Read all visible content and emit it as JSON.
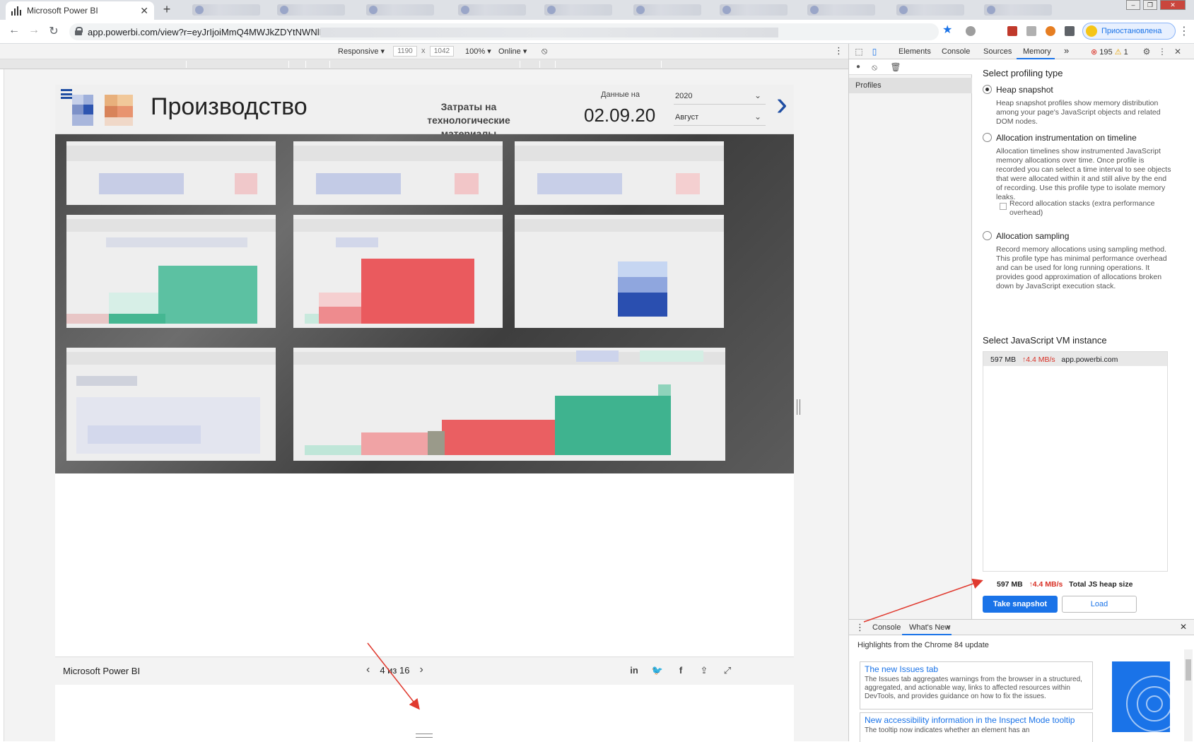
{
  "browser": {
    "active_tab_title": "Microsoft Power BI",
    "url": "app.powerbi.com/view?r=eyJrIjoiMmQ4MWJkZDYtNWNlMi",
    "profile_label": "Приостановлена"
  },
  "device_toolbar": {
    "mode": "Responsive ▾",
    "width": "1190",
    "x": "x",
    "height": "1042",
    "zoom": "100% ▾",
    "network": "Online ▾"
  },
  "report": {
    "title": "Производство",
    "subtitle": "Затраты на технологические материалы",
    "date_label": "Данные на",
    "date_value": "02.09.20",
    "year_slicer": "2020",
    "month_slicer": "Август",
    "footer_brand": "Microsoft Power BI",
    "pager": "4 из 16"
  },
  "devtools": {
    "tabs": [
      "Elements",
      "Console",
      "Sources",
      "Memory"
    ],
    "more_tabs": "»",
    "error_count": "195",
    "warning_count": "1",
    "sidebar_item": "Profiles",
    "select_type_heading": "Select profiling type",
    "options": [
      {
        "label": "Heap snapshot",
        "selected": true,
        "desc": "Heap snapshot profiles show memory distribution among your page's JavaScript objects and related DOM nodes."
      },
      {
        "label": "Allocation instrumentation on timeline",
        "selected": false,
        "desc": "Allocation timelines show instrumented JavaScript memory allocations over time. Once profile is recorded you can select a time interval to see objects that were allocated within it and still alive by the end of recording. Use this profile type to isolate memory leaks."
      },
      {
        "label": "Allocation sampling",
        "selected": false,
        "desc": "Record memory allocations using sampling method. This profile type has minimal performance overhead and can be used for long running operations. It provides good approximation of allocations broken down by JavaScript execution stack."
      }
    ],
    "record_stacks_label": "Record allocation stacks (extra performance overhead)",
    "vm_heading": "Select JavaScript VM instance",
    "vm_instance": {
      "size": "597 MB",
      "rate": "↑4.4 MB/s",
      "host": "app.powerbi.com"
    },
    "summary": {
      "size": "597 MB",
      "rate": "↑4.4 MB/s",
      "label": "Total JS heap size"
    },
    "take_snapshot": "Take snapshot",
    "load": "Load",
    "drawer": {
      "tabs": [
        "Console",
        "What's New"
      ],
      "close": "×",
      "highlights": "Highlights from the Chrome 84 update",
      "news": [
        {
          "title": "The new Issues tab",
          "desc": "The Issues tab aggregates warnings from the browser in a structured, aggregated, and actionable way, links to affected resources within DevTools, and provides guidance on how to fix the issues."
        },
        {
          "title": "New accessibility information in the Inspect Mode tooltip",
          "desc": "The tooltip now indicates whether an element has an"
        }
      ]
    }
  },
  "colors": {
    "accent": "#1a73e8",
    "report_blue": "#1f4ea3",
    "teal": "#3db896",
    "red": "#e84f53",
    "annotation": "#e03a2f"
  }
}
